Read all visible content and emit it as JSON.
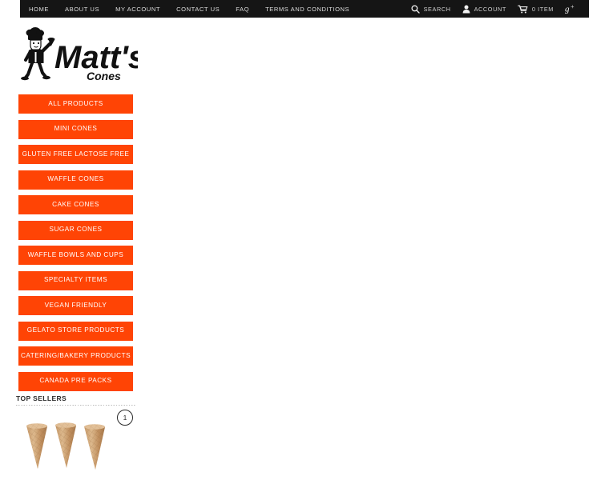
{
  "topbar": {
    "nav_items": [
      {
        "label": "HOME",
        "name": "nav-home"
      },
      {
        "label": "ABOUT US",
        "name": "nav-about-us"
      },
      {
        "label": "MY ACCOUNT",
        "name": "nav-my-account"
      },
      {
        "label": "CONTACT US",
        "name": "nav-contact-us"
      },
      {
        "label": "FAQ",
        "name": "nav-faq"
      },
      {
        "label": "TERMS AND CONDITIONS",
        "name": "nav-terms-and-conditions"
      }
    ],
    "search_label": "SEARCH",
    "search_icon": "search-icon",
    "account_label": "ACCOUNT",
    "account_icon": "user-icon",
    "cart_label": "0 ITEM",
    "cart_icon": "shopping-cart-icon",
    "social_icon": "google-plus-icon",
    "background_color": "#151515",
    "text_color": "#dcdcdc"
  },
  "logo": {
    "brand_name": "Matt's",
    "brand_subtitle": "Cones",
    "icon": "chef-with-cone-icon"
  },
  "sidebar": {
    "accent_color": "#FF4405",
    "categories": [
      {
        "label": "ALL PRODUCTS",
        "name": "category-all-products"
      },
      {
        "label": "MINI CONES",
        "name": "category-mini-cones"
      },
      {
        "label": "GLUTEN FREE LACTOSE FREE",
        "name": "category-gluten-free-lactose-free"
      },
      {
        "label": "WAFFLE CONES",
        "name": "category-waffle-cones"
      },
      {
        "label": "CAKE CONES",
        "name": "category-cake-cones"
      },
      {
        "label": "SUGAR CONES",
        "name": "category-sugar-cones"
      },
      {
        "label": "WAFFLE BOWLS AND CUPS",
        "name": "category-waffle-bowls-and-cups"
      },
      {
        "label": "SPECIALTY ITEMS",
        "name": "category-specialty-items"
      },
      {
        "label": "VEGAN FRIENDLY",
        "name": "category-vegan-friendly"
      },
      {
        "label": "GELATO STORE PRODUCTS",
        "name": "category-gelato-store-products"
      },
      {
        "label": "CATERING/BAKERY PRODUCTS",
        "name": "category-catering-bakery-products"
      },
      {
        "label": "CANADA PRE PACKS",
        "name": "category-canada-pre-packs"
      }
    ]
  },
  "top_sellers": {
    "heading": "TOP SELLERS",
    "slide_number": "1",
    "product_image": "waffle-cones-product-image"
  }
}
